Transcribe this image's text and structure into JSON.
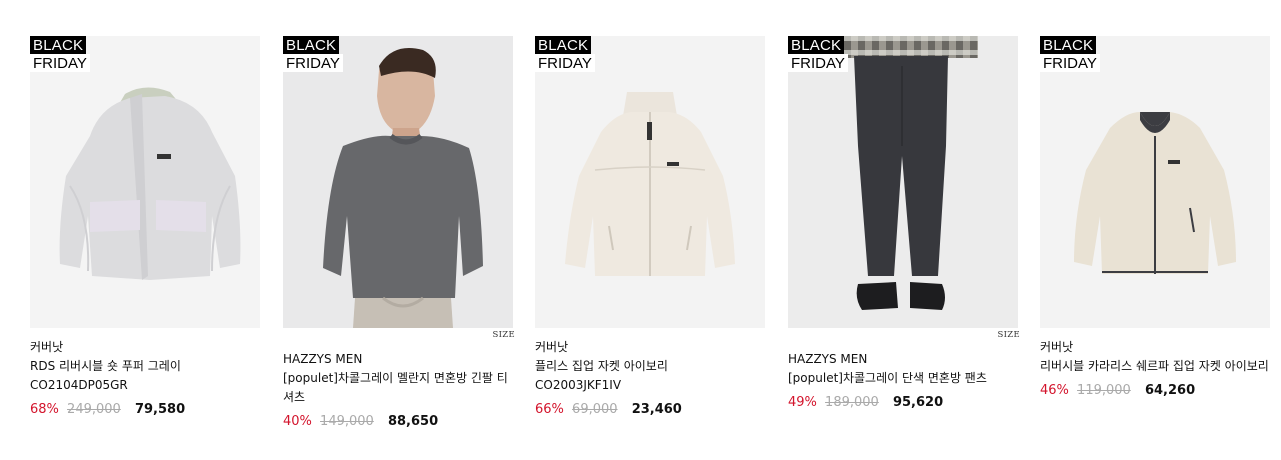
{
  "badge": {
    "line1": "BLACK",
    "line2": "FRIDAY"
  },
  "size_label": "SIZE",
  "products": [
    {
      "brand": "커버낫",
      "name": "RDS 리버시블 숏 푸퍼 그레이",
      "code": "CO2104DP05GR",
      "discount": "68%",
      "original_price": "249,000",
      "sale_price": "79,580"
    },
    {
      "brand": "HAZZYS MEN",
      "name": "[populet]차콜그레이 멜란지 면혼방 긴팔 티셔츠",
      "code": "",
      "discount": "40%",
      "original_price": "149,000",
      "sale_price": "88,650"
    },
    {
      "brand": "커버낫",
      "name": "플리스 집업 자켓 아이보리",
      "code": "CO2003JKF1IV",
      "discount": "66%",
      "original_price": "69,000",
      "sale_price": "23,460"
    },
    {
      "brand": "HAZZYS MEN",
      "name": "[populet]차콜그레이 단색 면혼방 팬츠",
      "code": "",
      "discount": "49%",
      "original_price": "189,000",
      "sale_price": "95,620"
    },
    {
      "brand": "커버낫",
      "name": "리버시블 카라리스 쉐르파 집업 자켓 아이보리",
      "code": "",
      "discount": "46%",
      "original_price": "119,000",
      "sale_price": "64,260"
    }
  ],
  "colors": {
    "discount": "#d3142c",
    "thumb_bg": "#f1f1f1",
    "badge_bg": "#000000"
  }
}
